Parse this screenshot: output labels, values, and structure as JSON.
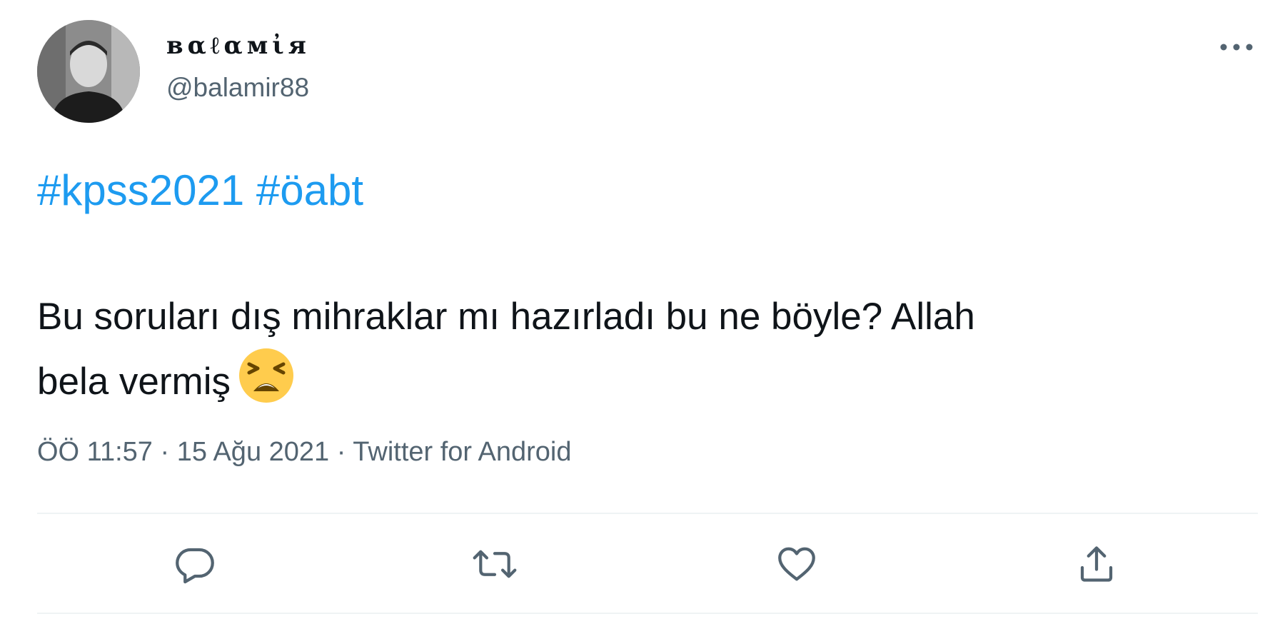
{
  "user": {
    "display_name": "вαℓαмἰя",
    "handle": "@balamir88"
  },
  "tweet": {
    "hashtags": [
      "#kpss2021",
      "#öabt"
    ],
    "text_line1": "Bu soruları dış mihraklar mı hazırladı bu ne böyle? Allah",
    "text_line2": "bela vermiş",
    "emoji": "tired-face-emoji",
    "time": "ÖÖ 11:57",
    "date": "15 Ağu 2021",
    "separator": "·",
    "source": "Twitter for Android"
  },
  "actions": [
    {
      "name": "reply",
      "icon": "reply-icon"
    },
    {
      "name": "retweet",
      "icon": "retweet-icon"
    },
    {
      "name": "like",
      "icon": "heart-icon"
    },
    {
      "name": "share",
      "icon": "share-icon"
    }
  ],
  "colors": {
    "accent": "#1d9bf0",
    "text": "#0f1419",
    "secondary": "#536471",
    "divider": "#eff3f4",
    "emoji": "#ffcc4d"
  }
}
